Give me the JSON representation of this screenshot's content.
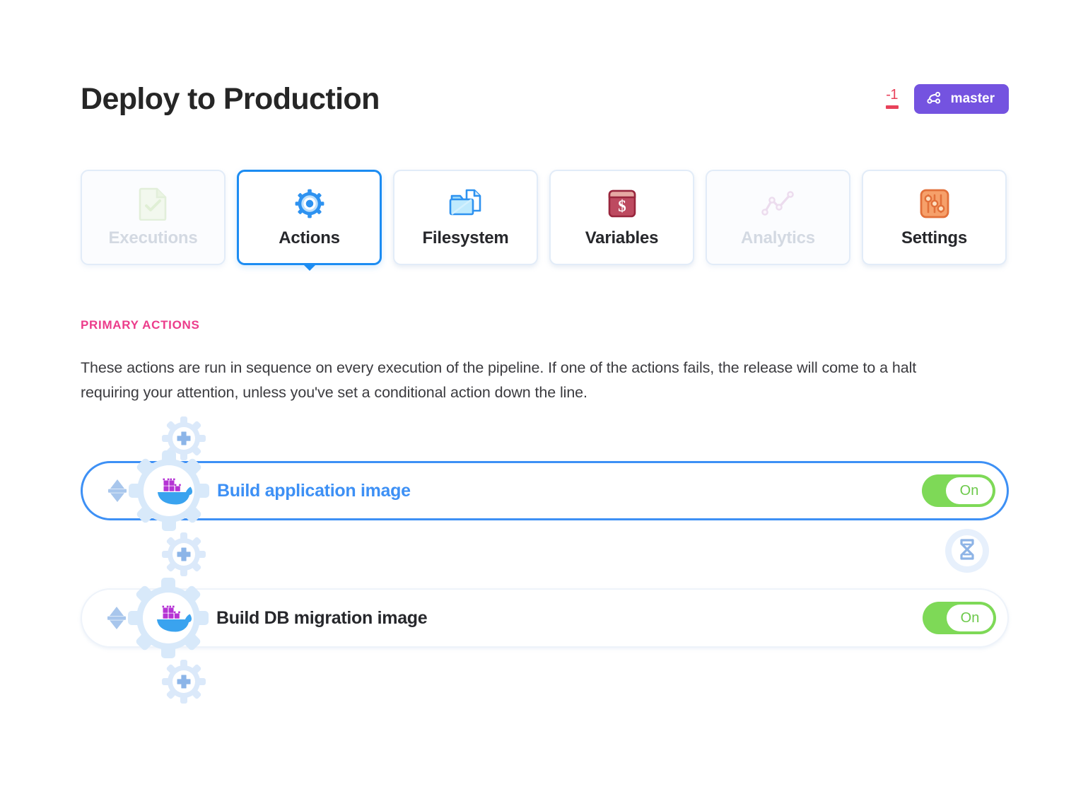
{
  "header": {
    "title": "Deploy to Production",
    "commit_diff": "-1",
    "branch": "master"
  },
  "tabs": [
    {
      "label": "Executions",
      "icon": "document-check-icon",
      "state": "disabled"
    },
    {
      "label": "Actions",
      "icon": "gear-icon",
      "state": "active"
    },
    {
      "label": "Filesystem",
      "icon": "folder-file-icon",
      "state": "normal"
    },
    {
      "label": "Variables",
      "icon": "dollar-book-icon",
      "state": "normal"
    },
    {
      "label": "Analytics",
      "icon": "line-chart-icon",
      "state": "disabled"
    },
    {
      "label": "Settings",
      "icon": "sliders-icon",
      "state": "normal"
    }
  ],
  "section": {
    "label": "PRIMARY ACTIONS",
    "description": "These actions are run in sequence on every execution of the pipeline. If one of the actions fails, the release will come to a halt requiring your attention, unless you've set a conditional action down the line."
  },
  "actions": [
    {
      "name": "Build application image",
      "icon": "docker-icon",
      "toggle_label": "On",
      "toggle_state": "on",
      "selected": true
    },
    {
      "name": "Build DB migration image",
      "icon": "docker-icon",
      "toggle_label": "On",
      "toggle_state": "on",
      "selected": false
    }
  ],
  "colors": {
    "accent_blue": "#3d90f5",
    "tab_active": "#1c8cf2",
    "pink": "#ec3c8b",
    "purple": "#7453e0",
    "red": "#e8415a",
    "green": "#7ed957"
  }
}
